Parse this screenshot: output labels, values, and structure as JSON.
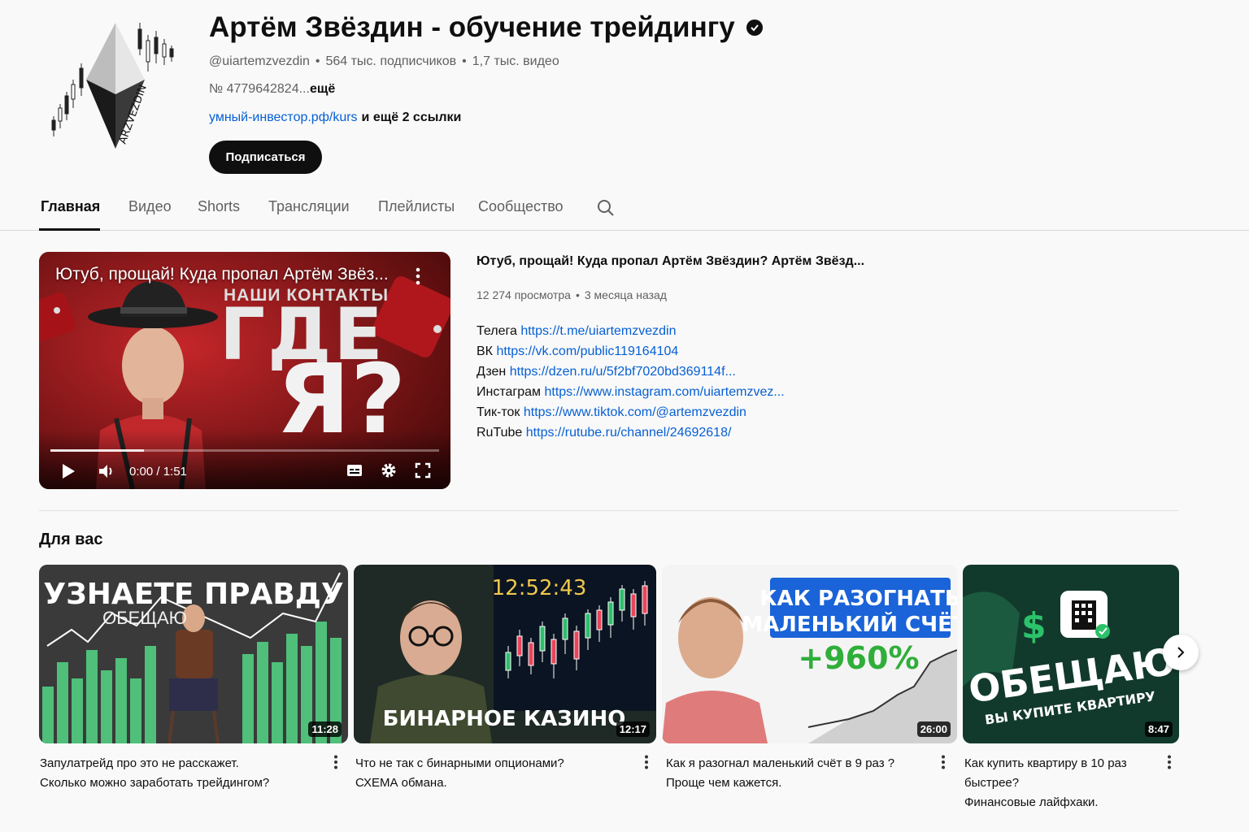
{
  "channel": {
    "title": "Артём Звёздин - обучение трейдингу",
    "handle": "@uiartemzvezdin",
    "subscribers": "564 тыс. подписчиков",
    "video_count": "1,7 тыс. видео",
    "description": "№ 4779642824...",
    "description_more": "ещё",
    "link": "умный-инвестор.рф/kurs",
    "link_extra": "и ещё 2 ссылки",
    "subscribe_label": "Подписаться",
    "avatar_text": "ARZVEZDIN"
  },
  "tabs": [
    "Главная",
    "Видео",
    "Shorts",
    "Трансляции",
    "Плейлисты",
    "Сообщество"
  ],
  "featured": {
    "player_title": "Ютуб, прощай! Куда пропал Артём Звёз...",
    "thumb_contacts": "НАШИ КОНТАКТЫ",
    "thumb_gde": "ГДЕ",
    "thumb_ya": "Я?",
    "time": "0:00 / 1:51",
    "progress": 0.24,
    "title": "Ютуб, прощай! Куда пропал Артём Звёздин?  Артём Звёзд...",
    "views": "12 274 просмотра",
    "age": "3 месяца назад",
    "links": [
      {
        "label": "Телега",
        "url": "https://t.me/uiartemzvezdin"
      },
      {
        "label": "ВК",
        "url": "https://vk.com/public119164104"
      },
      {
        "label": "Дзен",
        "url": "https://dzen.ru/u/5f2bf7020bd369114f..."
      },
      {
        "label": "Инстаграм",
        "url": "https://www.instagram.com/uiartemzvez..."
      },
      {
        "label": "Тик-ток",
        "url": "https://www.tiktok.com/@artemzvezdin"
      },
      {
        "label": "RuTube",
        "url": "https://rutube.ru/channel/24692618/"
      }
    ]
  },
  "section": {
    "title": "Для вас",
    "videos": [
      {
        "duration": "11:28",
        "thumb_top": "УЗНАЕТЕ ПРАВДУ",
        "thumb_sub": "ОБЕЩАЮ",
        "title_1": "Запулатрейд про это не расскажет.",
        "title_2": "Сколько можно заработать трейдингом?"
      },
      {
        "duration": "12:17",
        "thumb_clock": "12:52:43",
        "thumb_bottom": "БИНАРНОЕ КАЗИНО",
        "title_1": "Что не так с бинарными опционами?",
        "title_2": "СХЕМА обмана."
      },
      {
        "duration": "26:00",
        "thumb_box_1": "КАК РАЗОГНАТЬ",
        "thumb_box_2": "МАЛЕНЬКИЙ СЧЁТ?",
        "thumb_pct": "+960%",
        "title_1": "Как я разогнал маленький счёт в 9 раз ?",
        "title_2": "Проще чем кажется."
      },
      {
        "duration": "8:47",
        "thumb_big": "ОБЕЩАЮ",
        "thumb_sub": "ВЫ КУПИТЕ КВАРТИРУ",
        "title_1": "Как купить квартиру в 10 раз",
        "title_2": "быстрее?",
        "title_3": "Финансовые лайфхаки."
      }
    ]
  },
  "colors": {
    "accent_link": "#065fd4",
    "text": "#0f0f0f",
    "secondary": "#606060",
    "background": "#f9f9f9"
  }
}
